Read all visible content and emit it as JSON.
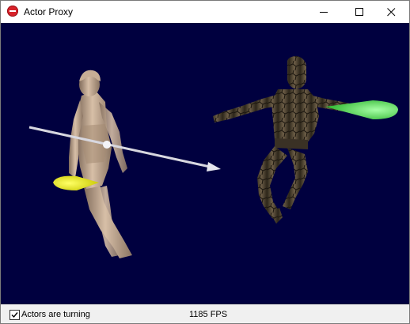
{
  "window": {
    "title": "Actor Proxy"
  },
  "icons": {
    "app": "app-icon",
    "minimize": "minimize-icon",
    "maximize": "maximize-icon",
    "close": "close-icon",
    "checkmark": "checkmark-icon"
  },
  "scene": {
    "background_color": "#00003f",
    "actors": [
      {
        "name": "female-figure",
        "cone_color": "#e8e81e"
      },
      {
        "name": "stone-figure",
        "cone_color": "#55e055"
      }
    ],
    "arrow_color": "#d8d8e0"
  },
  "status": {
    "checkbox_label": "Actors are turning",
    "checkbox_checked": true,
    "fps": "1185 FPS"
  }
}
